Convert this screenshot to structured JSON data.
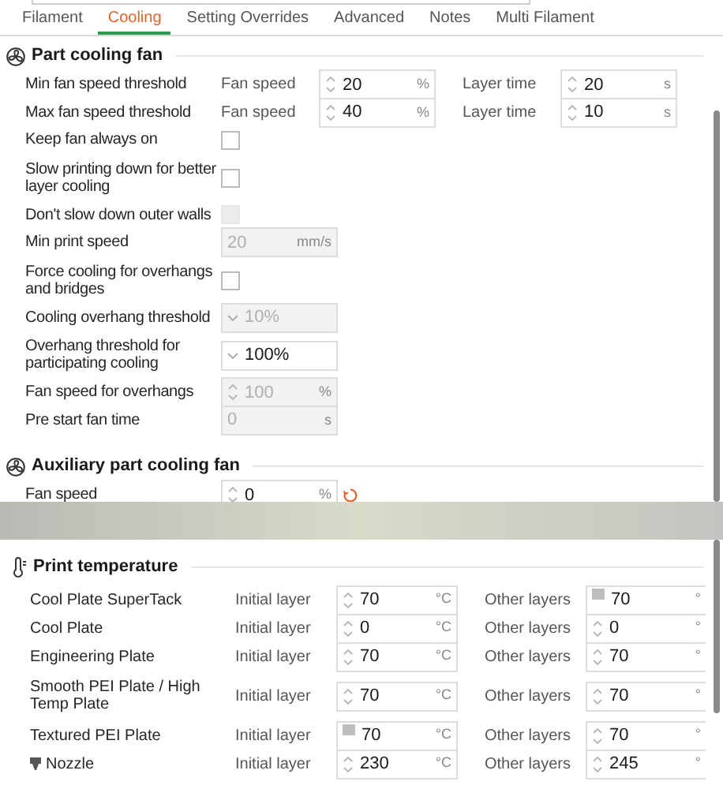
{
  "tabs": [
    {
      "label": "Filament",
      "selected": false
    },
    {
      "label": "Cooling",
      "selected": true
    },
    {
      "label": "Setting Overrides",
      "selected": false
    },
    {
      "label": "Advanced",
      "selected": false
    },
    {
      "label": "Notes",
      "selected": false
    },
    {
      "label": "Multi Filament",
      "selected": false
    }
  ],
  "part_cooling_fan": {
    "title": "Part cooling fan",
    "rows": [
      {
        "kind": "pair",
        "label": "Min fan speed threshold",
        "fields": [
          {
            "caption": "Fan speed",
            "value": "20",
            "unit": "%"
          },
          {
            "caption": "Layer time",
            "value": "20",
            "unit": "s"
          }
        ]
      },
      {
        "kind": "pair",
        "label": "Max fan speed threshold",
        "fields": [
          {
            "caption": "Fan speed",
            "value": "40",
            "unit": "%"
          },
          {
            "caption": "Layer time",
            "value": "10",
            "unit": "s"
          }
        ]
      },
      {
        "kind": "checkbox",
        "label": "Keep fan always on",
        "checked": false,
        "disabled": false
      },
      {
        "kind": "checkbox",
        "label": "Slow printing down for better layer cooling",
        "checked": false,
        "disabled": false
      },
      {
        "kind": "checkbox",
        "label": "Don't slow down outer walls",
        "checked": false,
        "disabled": true
      },
      {
        "kind": "text",
        "label": "Min print speed",
        "value": "20",
        "unit": "mm/s",
        "disabled": true
      },
      {
        "kind": "checkbox",
        "label": "Force cooling for overhangs and bridges",
        "checked": false,
        "disabled": false
      },
      {
        "kind": "dropdown",
        "label": "Cooling overhang threshold",
        "value": "10%",
        "disabled": true
      },
      {
        "kind": "dropdown",
        "label": "Overhang threshold for participating cooling",
        "value": "100%",
        "disabled": false
      },
      {
        "kind": "spin",
        "label": "Fan speed for overhangs",
        "value": "100",
        "unit": "%",
        "disabled": true
      },
      {
        "kind": "text",
        "label": "Pre start fan time",
        "value": "0",
        "unit": "s",
        "disabled": true
      }
    ]
  },
  "auxiliary_part_cooling_fan": {
    "title": "Auxiliary part cooling fan",
    "rows": [
      {
        "kind": "spin",
        "label": "Fan speed",
        "value": "0",
        "unit": "%",
        "disabled": false,
        "reset": true
      }
    ]
  },
  "print_temperature": {
    "title": "Print temperature",
    "rows": [
      {
        "label": "Cool Plate SuperTack",
        "fields": [
          {
            "caption": "Initial layer",
            "value": "70",
            "unit": "°C",
            "kind": "spin"
          },
          {
            "caption": "Other layers",
            "value": "70",
            "unit": "°",
            "kind": "marked"
          }
        ]
      },
      {
        "label": "Cool Plate",
        "fields": [
          {
            "caption": "Initial layer",
            "value": "0",
            "unit": "°C",
            "kind": "spin"
          },
          {
            "caption": "Other layers",
            "value": "0",
            "unit": "°",
            "kind": "spin"
          }
        ]
      },
      {
        "label": "Engineering Plate",
        "fields": [
          {
            "caption": "Initial layer",
            "value": "70",
            "unit": "°C",
            "kind": "spin"
          },
          {
            "caption": "Other layers",
            "value": "70",
            "unit": "°",
            "kind": "spin"
          }
        ]
      },
      {
        "label": "Smooth PEI Plate / High Temp Plate",
        "fields": [
          {
            "caption": "Initial layer",
            "value": "70",
            "unit": "°C",
            "kind": "spin"
          },
          {
            "caption": "Other layers",
            "value": "70",
            "unit": "°",
            "kind": "spin"
          }
        ]
      },
      {
        "label": "Textured PEI Plate",
        "fields": [
          {
            "caption": "Initial layer",
            "value": "70",
            "unit": "°C",
            "kind": "marked"
          },
          {
            "caption": "Other layers",
            "value": "70",
            "unit": "°",
            "kind": "spin"
          }
        ]
      },
      {
        "label": "Nozzle",
        "kind": "nozzle",
        "fields": [
          {
            "caption": "Initial layer",
            "value": "230",
            "unit": "°C",
            "kind": "spin"
          },
          {
            "caption": "Other layers",
            "value": "245",
            "unit": "°",
            "kind": "spin"
          }
        ]
      }
    ]
  }
}
